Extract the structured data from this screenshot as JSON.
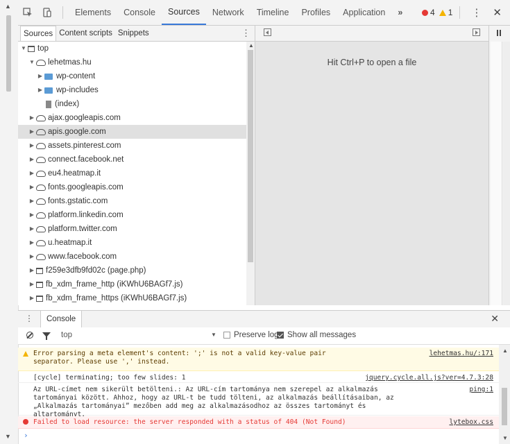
{
  "toolbar": {
    "inspect_icon": "cursor-select-icon",
    "device_icon": "device-mode-icon",
    "tabs": [
      {
        "label": "Elements"
      },
      {
        "label": "Console"
      },
      {
        "label": "Sources",
        "active": true
      },
      {
        "label": "Network"
      },
      {
        "label": "Timeline"
      },
      {
        "label": "Profiles"
      },
      {
        "label": "Application"
      }
    ],
    "more_tabs": "»",
    "error_count": "4",
    "warning_count": "1",
    "menu_glyph": "⋮",
    "close_glyph": "✕"
  },
  "navigator": {
    "tabs": [
      "Sources",
      "Content scripts",
      "Snippets"
    ],
    "kebab": "⋮",
    "tree": [
      {
        "label": "top",
        "type": "frame",
        "level": 0,
        "expanded": true
      },
      {
        "label": "lehetmas.hu",
        "type": "domain",
        "level": 1,
        "expanded": true
      },
      {
        "label": "wp-content",
        "type": "folder",
        "level": 2,
        "expanded": false
      },
      {
        "label": "wp-includes",
        "type": "folder",
        "level": 2,
        "expanded": false
      },
      {
        "label": "(index)",
        "type": "file",
        "level": 2
      },
      {
        "label": "ajax.googleapis.com",
        "type": "domain",
        "level": 1,
        "expanded": false
      },
      {
        "label": "apis.google.com",
        "type": "domain",
        "level": 1,
        "expanded": false,
        "selected": true
      },
      {
        "label": "assets.pinterest.com",
        "type": "domain",
        "level": 1,
        "expanded": false
      },
      {
        "label": "connect.facebook.net",
        "type": "domain",
        "level": 1,
        "expanded": false
      },
      {
        "label": "eu4.heatmap.it",
        "type": "domain",
        "level": 1,
        "expanded": false
      },
      {
        "label": "fonts.googleapis.com",
        "type": "domain",
        "level": 1,
        "expanded": false
      },
      {
        "label": "fonts.gstatic.com",
        "type": "domain",
        "level": 1,
        "expanded": false
      },
      {
        "label": "platform.linkedin.com",
        "type": "domain",
        "level": 1,
        "expanded": false
      },
      {
        "label": "platform.twitter.com",
        "type": "domain",
        "level": 1,
        "expanded": false
      },
      {
        "label": "u.heatmap.it",
        "type": "domain",
        "level": 1,
        "expanded": false
      },
      {
        "label": "www.facebook.com",
        "type": "domain",
        "level": 1,
        "expanded": false
      },
      {
        "label": "f259e3dfb9fd02c (page.php)",
        "type": "frame",
        "level": 1,
        "expanded": false
      },
      {
        "label": "fb_xdm_frame_http (iKWhU6BAGf7.js)",
        "type": "frame",
        "level": 1,
        "expanded": false
      },
      {
        "label": "fb_xdm_frame_https (iKWhU6BAGf7.js)",
        "type": "frame",
        "level": 1,
        "expanded": false
      }
    ]
  },
  "editor": {
    "hint": "Hit Ctrl+P to open a file"
  },
  "drawer": {
    "tab_label": "Console",
    "kebab": "⋮",
    "close_glyph": "✕"
  },
  "console_filter": {
    "context": "top",
    "preserve_log_label": "Preserve log",
    "preserve_log_checked": false,
    "show_all_label": "Show all messages",
    "show_all_checked": true
  },
  "console": {
    "messages": [
      {
        "level": "warning",
        "text": "Error parsing a meta element's content: ';' is not a valid key-value pair\nseparator. Please use ',' instead.",
        "source": "lehetmas.hu/:171"
      },
      {
        "level": "log",
        "text": "[cycle] terminating; too few slides: 1",
        "source": "jquery.cycle.all.js?ver=4.7.3:28"
      },
      {
        "level": "log",
        "text": "Az URL-címet nem sikerült betölteni.: Az URL-cím tartománya nem szerepel az alkalmazás\ntartományai között. Ahhoz, hogy az URL-t be tudd tölteni, az alkalmazás beállításaiban, az\n„Alkalmazás tartományai” mezőben add meg az alkalmazásodhoz az összes tartományt és altartományt.",
        "source": "ping:1"
      },
      {
        "level": "error",
        "text": "Failed to load resource: the server responded with a status of 404 (Not Found)",
        "source": "lytebox.css"
      }
    ],
    "prompt": "›"
  },
  "colors": {
    "accent": "#3879d9",
    "error": "#e53935",
    "warning": "#f4b400",
    "folder": "#5b9bd5"
  }
}
